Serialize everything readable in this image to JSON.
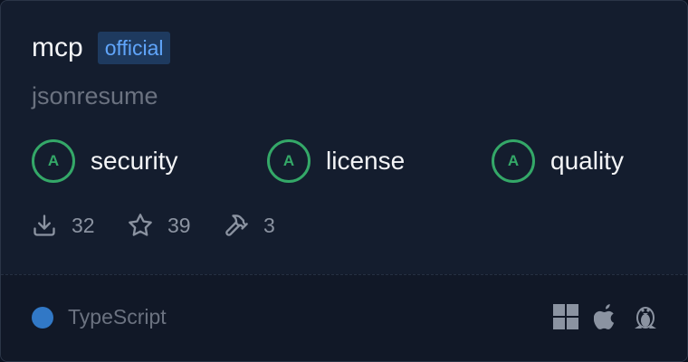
{
  "package": {
    "name": "mcp",
    "badge": "official",
    "owner": "jsonresume"
  },
  "scores": [
    {
      "grade": "A",
      "label": "security"
    },
    {
      "grade": "A",
      "label": "license"
    },
    {
      "grade": "A",
      "label": "quality"
    }
  ],
  "stats": {
    "downloads": "32",
    "stars": "39",
    "tools": "3"
  },
  "language": {
    "name": "TypeScript",
    "color": "#3178c6"
  },
  "platforms": [
    "windows-icon",
    "apple-icon",
    "linux-icon"
  ],
  "colors": {
    "grade_green": "#34a868",
    "badge_blue": "#60a5fa"
  }
}
